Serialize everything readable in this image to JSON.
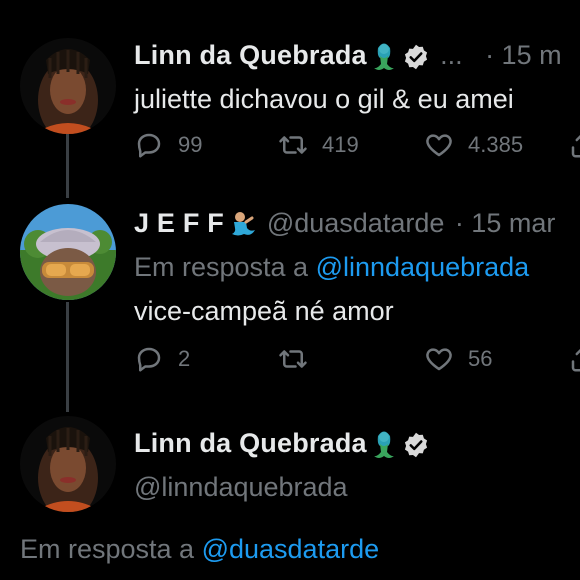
{
  "tweet1": {
    "display_name": "Linn da Quebrada",
    "ellipsis": "...",
    "time": "· 15 m",
    "text": "juliette dichavou o gil & eu amei",
    "replies": "99",
    "retweets": "419",
    "likes": "4.385"
  },
  "tweet2": {
    "display_name": "J E F F",
    "handle": "@duasdatarde",
    "time": "· 15 mar",
    "reply_prefix": "Em resposta a ",
    "reply_to": "@linndaquebrada",
    "text": "vice-campeã né amor",
    "replies": "2",
    "retweets": "",
    "likes": "56"
  },
  "tweet3": {
    "display_name": "Linn da Quebrada",
    "handle": "@linndaquebrada",
    "reply_prefix": "Em resposta a ",
    "reply_to": "@duasdatarde"
  },
  "colors": {
    "background": "#000000",
    "text": "#e7e9ea",
    "muted": "#71767b",
    "link": "#1d9bf0"
  },
  "icons": [
    "mermaid-emoji",
    "verified-badge-icon",
    "reply-icon",
    "retweet-icon",
    "like-icon",
    "share-icon",
    "merman-emoji"
  ]
}
